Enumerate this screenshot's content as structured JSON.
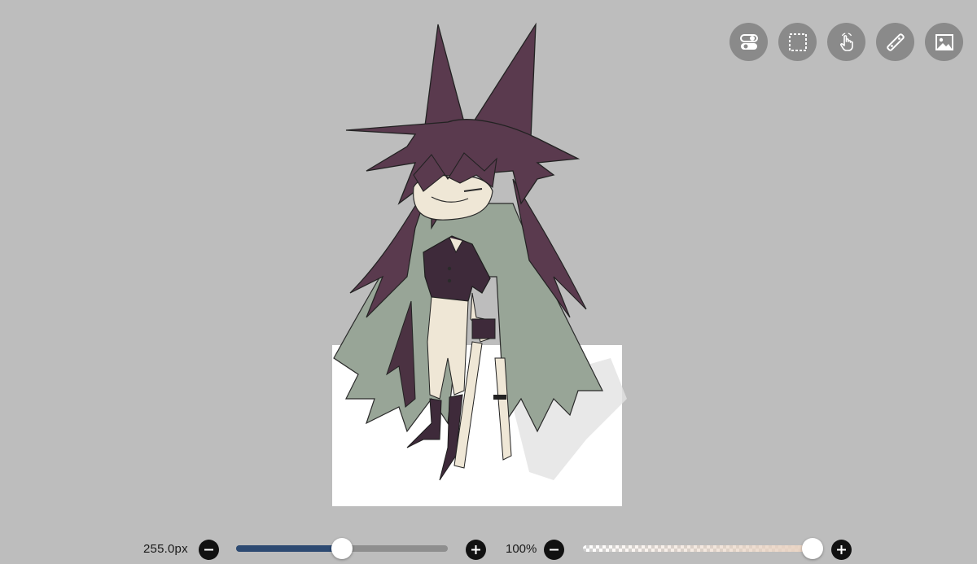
{
  "toolbar": {
    "tools": [
      {
        "name": "toggle-icon"
      },
      {
        "name": "selection-icon"
      },
      {
        "name": "hand-tool-icon"
      },
      {
        "name": "ruler-icon"
      },
      {
        "name": "image-icon"
      }
    ]
  },
  "brush": {
    "size_label": "255.0px",
    "size_fraction": 0.5
  },
  "opacity": {
    "label": "100%",
    "value_fraction": 1.0
  },
  "colors": {
    "background": "#bdbdbd",
    "size_fill": "#2d4a72",
    "brush_color": "#e9d3c2",
    "hair": "#5a3a4e",
    "cloak": "#98a597"
  }
}
